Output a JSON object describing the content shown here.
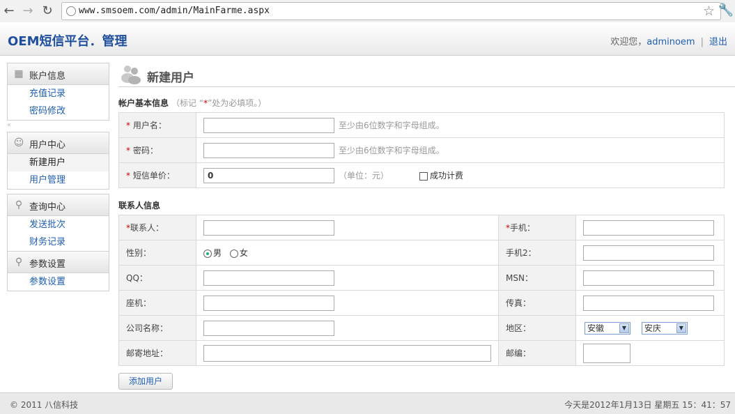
{
  "browser": {
    "url": "www.smsoem.com/admin/MainFarme.aspx"
  },
  "header": {
    "title": "OEM短信平台．管理",
    "welcome": "欢迎您，",
    "username": "adminoem",
    "separator": "|",
    "logout": "退出"
  },
  "sidebar": {
    "groups": [
      {
        "title": "账户信息",
        "icon": "calendar-icon",
        "items": [
          "充值记录",
          "密码修改"
        ]
      },
      {
        "title": "用户中心",
        "icon": "users-icon",
        "items": [
          "新建用户",
          "用户管理"
        ]
      },
      {
        "title": "查询中心",
        "icon": "magnifier-icon",
        "items": [
          "发送批次",
          "财务记录"
        ]
      },
      {
        "title": "参数设置",
        "icon": "magnifier-icon",
        "items": [
          "参数设置"
        ]
      }
    ],
    "collapse": "«"
  },
  "main": {
    "page_title": "新建用户",
    "basic_section": {
      "title": "帐户基本信息",
      "note_prefix": "（标记 “",
      "note_star": "*",
      "note_suffix": "”处为必填项。）",
      "fields": {
        "username_label": "用户名：",
        "username_hint": "至少由6位数字和字母组成。",
        "password_label": "密码：",
        "password_hint": "至少由6位数字和字母组成。",
        "price_label": "短信单价：",
        "price_value": "0",
        "price_unit": "（单位：元）",
        "success_billing": "成功计费"
      }
    },
    "contact_section": {
      "title": "联系人信息",
      "contact_label": "联系人：",
      "mobile_label": "手机：",
      "gender_label": "性别：",
      "gender_male": "男",
      "gender_female": "女",
      "gender_selected": "男",
      "mobile2_label": "手机2：",
      "qq_label": "QQ：",
      "msn_label": "MSN：",
      "phone_label": "座机：",
      "fax_label": "传真：",
      "company_label": "公司名称：",
      "region_label": "地区：",
      "province": "安徽",
      "city": "安庆",
      "address_label": "邮寄地址：",
      "zip_label": "邮编："
    },
    "submit_label": "添加用户"
  },
  "footer": {
    "copyright": "© 2011 八信科技",
    "datetime": "今天是2012年1月13日 星期五 15：41：57"
  }
}
